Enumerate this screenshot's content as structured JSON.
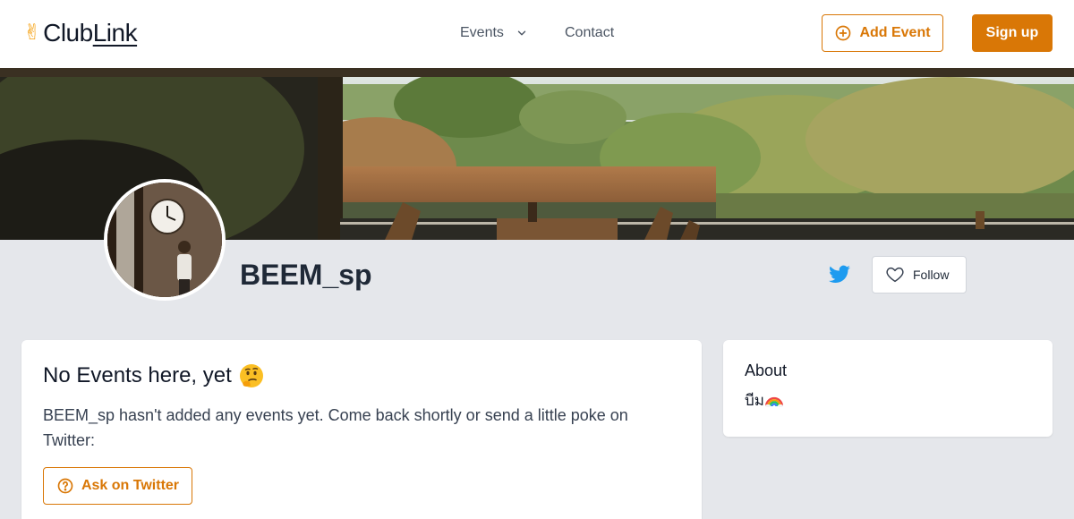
{
  "header": {
    "logo_prefix": "Club",
    "logo_suffix": "Link",
    "logo_icon": "victory-hand-icon",
    "nav": {
      "events_label": "Events",
      "contact_label": "Contact"
    },
    "add_event_label": "Add Event",
    "sign_up_label": "Sign up"
  },
  "profile": {
    "name": "BEEM_sp",
    "follow_label": "Follow",
    "twitter_icon": "twitter-icon"
  },
  "events_card": {
    "title": "No Events here, yet",
    "title_emoji": "thinking-face-icon",
    "message": "BEEM_sp hasn't added any events yet. Come back shortly or send a little poke on Twitter:",
    "ask_label": "Ask on Twitter"
  },
  "about_card": {
    "title": "About",
    "body": "บีม",
    "body_emoji": "rainbow-icon"
  },
  "colors": {
    "accent": "#d97706",
    "page_bg": "#e5e7eb",
    "twitter": "#1d9bf0"
  }
}
